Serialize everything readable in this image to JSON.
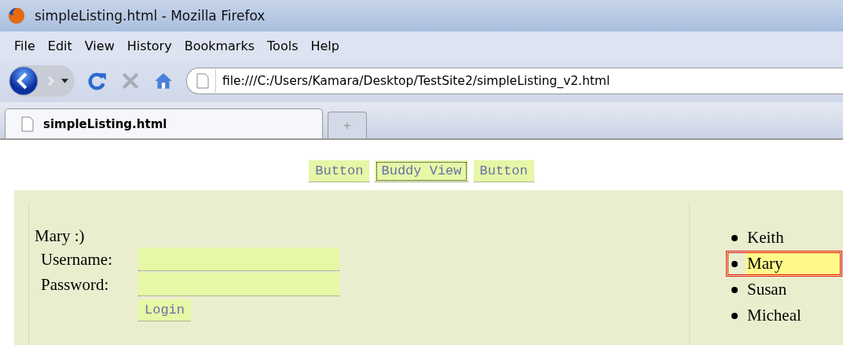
{
  "window": {
    "title": "simpleListing.html - Mozilla Firefox"
  },
  "menu": [
    "File",
    "Edit",
    "View",
    "History",
    "Bookmarks",
    "Tools",
    "Help"
  ],
  "address_bar": {
    "value": "file:///C:/Users/Kamara/Desktop/TestSite2/simpleListing_v2.html"
  },
  "tabs": [
    {
      "label": "simpleListing.html",
      "selected": true
    }
  ],
  "new_tab": "+",
  "page": {
    "buttons": [
      {
        "label": "Button",
        "focused": false
      },
      {
        "label": "Buddy View",
        "focused": true
      },
      {
        "label": "Button",
        "focused": false
      }
    ],
    "greeting": "Mary :)",
    "login": {
      "fields": [
        {
          "label": "Username:"
        },
        {
          "label": "Password:"
        }
      ],
      "button": "Login"
    },
    "buddies": [
      {
        "name": "Keith",
        "selected": false
      },
      {
        "name": "Mary",
        "selected": true
      },
      {
        "name": "Susan",
        "selected": false
      },
      {
        "name": "Micheal",
        "selected": false
      }
    ]
  }
}
